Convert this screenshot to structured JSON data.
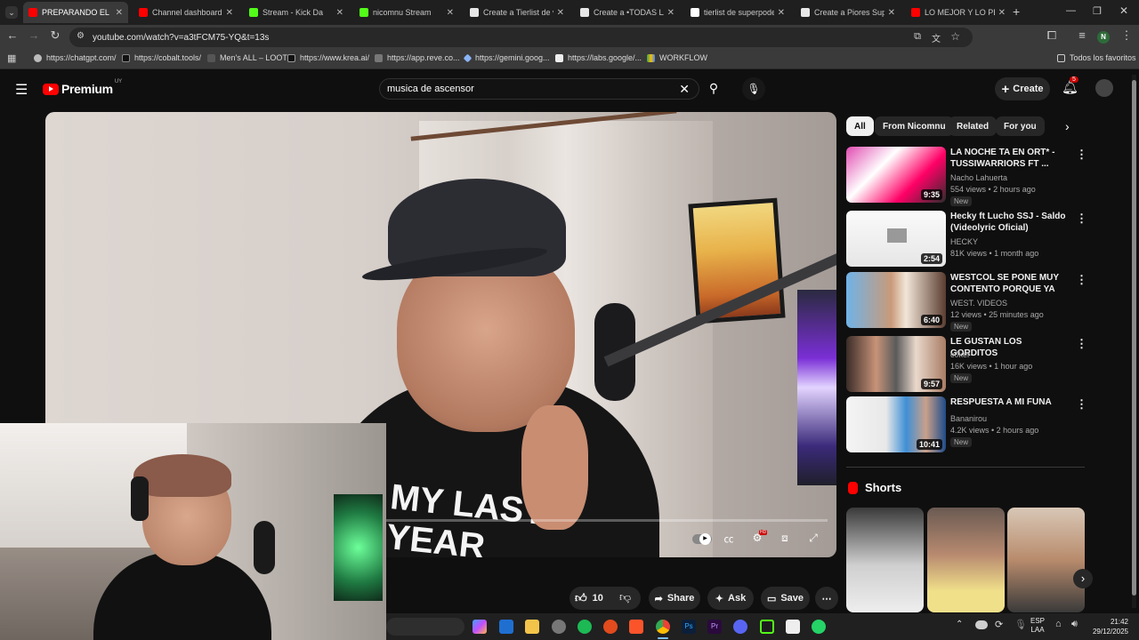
{
  "browser": {
    "tabs": [
      {
        "title": "PREPARANDO EL",
        "fav": "#ff0000"
      },
      {
        "title": "Channel dashboard",
        "fav": "#ff0000"
      },
      {
        "title": "Stream - Kick Da",
        "fav": "#53fc18"
      },
      {
        "title": "nicomnu Stream",
        "fav": "#53fc18"
      },
      {
        "title": "Create a Tierlist de vi",
        "fav": "#e7e7e7"
      },
      {
        "title": "Create a •TODAS LA",
        "fav": "#e7e7e7"
      },
      {
        "title": "tierlist de superpode",
        "fav": "#ffffff"
      },
      {
        "title": "Create a Piores Supe",
        "fav": "#e7e7e7"
      },
      {
        "title": "LO MEJOR Y LO PEO",
        "fav": "#ff0000"
      }
    ],
    "new_tab": "+",
    "url": "youtube.com/watch?v=a3tFCM75-YQ&t=13s",
    "profile_initial": "N",
    "bookmarks": [
      "https://chatgpt.com/",
      "https://cobalt.tools/",
      "Men's ALL – LOOT",
      "https://www.krea.ai/",
      "https://app.reve.co...",
      "https://gemini.goog...",
      "https://labs.google/...",
      "WORKFLOW"
    ],
    "all_bookmarks": "Todos los favoritos"
  },
  "youtube": {
    "logo": "Premium",
    "region": "UY",
    "search_value": "musica de ascensor",
    "create_label": "Create",
    "notif_count": "5",
    "actions": {
      "likes": "10",
      "share": "Share",
      "ask": "Ask",
      "save": "Save"
    },
    "chips": [
      "All",
      "From Nicomnu",
      "Related",
      "For you"
    ],
    "recommendations": [
      {
        "title": "LA NOCHE TA EN ORT* - TUSSIWARRIORS FT ...",
        "channel": "Nacho Lahuerta",
        "meta": "554 views • 2 hours ago",
        "badge": "New",
        "duration": "9:35"
      },
      {
        "title": "Hecky ft Lucho SSJ - Saldo (Videolyric Oficial)",
        "channel": "HECKY",
        "meta": "81K views • 1 month ago",
        "badge": "",
        "duration": "2:54"
      },
      {
        "title": "WESTCOL SE PONE MUY CONTENTO PORQUE YA NACI...",
        "channel": "WEST. VIDEOS",
        "meta": "12 views • 25 minutes ago",
        "badge": "New",
        "duration": "6:40"
      },
      {
        "title": "LE GUSTAN LOS GORDITOS",
        "channel": "c0ker",
        "meta": "16K views • 1 hour ago",
        "badge": "New",
        "duration": "9:57"
      },
      {
        "title": "RESPUESTA A MI FUNA",
        "channel": "Bananirou",
        "meta": "4.2K views • 2 hours ago",
        "badge": "New",
        "duration": "10:41"
      }
    ],
    "shorts_label": "Shorts"
  },
  "taskbar": {
    "lang": "ESP",
    "layout": "LAA",
    "time": "21:42",
    "date": "29/12/2025"
  }
}
